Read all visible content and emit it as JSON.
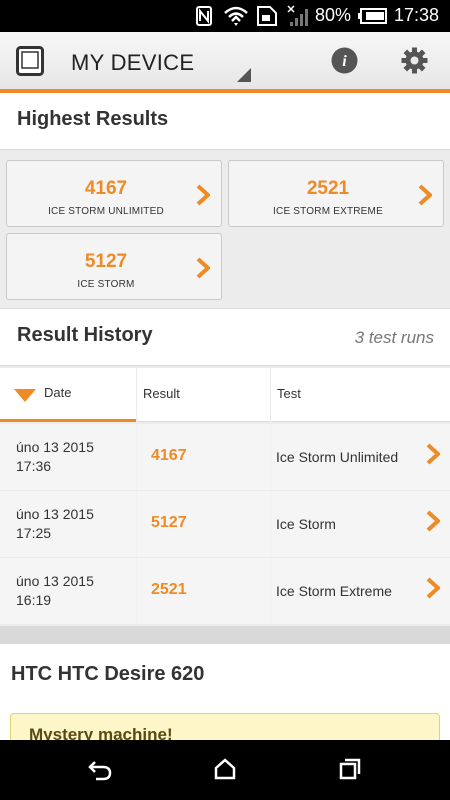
{
  "status_bar": {
    "battery": "80%",
    "time": "17:38"
  },
  "app_bar": {
    "title": "MY DEVICE"
  },
  "highest_results": {
    "title": "Highest Results",
    "cards": [
      {
        "value": "4167",
        "label": "ICE STORM UNLIMITED"
      },
      {
        "value": "2521",
        "label": "ICE STORM EXTREME"
      },
      {
        "value": "5127",
        "label": "ICE STORM"
      }
    ]
  },
  "result_history": {
    "title": "Result History",
    "count": "3 test runs",
    "columns": [
      "Date",
      "Result",
      "Test"
    ],
    "rows": [
      {
        "date_line1": "úno 13 2015",
        "date_line2": "17:36",
        "result": "4167",
        "test": "Ice Storm Unlimited"
      },
      {
        "date_line1": "úno 13 2015",
        "date_line2": "17:25",
        "result": "5127",
        "test": "Ice Storm"
      },
      {
        "date_line1": "úno 13 2015",
        "date_line2": "16:19",
        "result": "2521",
        "test": "Ice Storm Extreme"
      }
    ]
  },
  "device": {
    "name": "HTC HTC Desire 620",
    "notice": "Mystery machine!"
  },
  "colors": {
    "accent": "#f08a24"
  },
  "icons": [
    "nfc-icon",
    "wifi-icon",
    "sim-icon",
    "signal-icon",
    "battery-icon",
    "device-tablet-icon",
    "info-icon",
    "gear-icon",
    "chevron-right-icon",
    "sort-desc-icon",
    "back-icon",
    "home-icon",
    "recents-icon"
  ]
}
